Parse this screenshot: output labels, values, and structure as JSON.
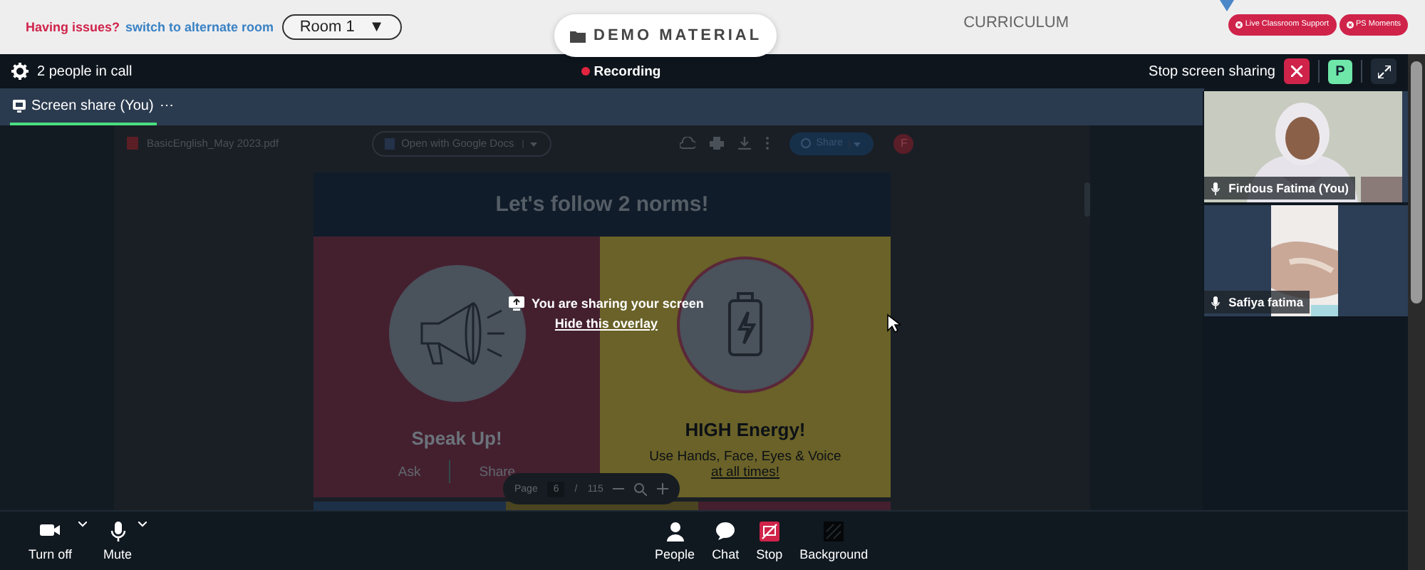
{
  "top_bar": {
    "issue_label": "Having issues?",
    "switch_link": "switch to alternate room",
    "room_select": {
      "value": "Room 1",
      "caret": "▼"
    },
    "demo_button": "DEMO MATERIAL",
    "curriculum_tab": "CURRICULUM",
    "support_buttons": [
      "Live Classroom Support",
      "PS Moments"
    ]
  },
  "call_header": {
    "people_count": "2 people in call",
    "recording": "Recording",
    "stop_sharing": "Stop screen sharing",
    "avatar": "P"
  },
  "tabs": [
    {
      "label": "Screen share (You)",
      "selected": true,
      "more": "⋯"
    }
  ],
  "shared_screen": {
    "file_name": "BasicEnglish_May 2023.pdf",
    "open_with": "Open with Google Docs",
    "share": "Share",
    "account": "F",
    "slide": {
      "title": "Let's follow 2 norms!",
      "left_heading": "Speak Up!",
      "left_items": [
        "Ask",
        "Share"
      ],
      "right_heading": "HIGH Energy!",
      "right_text": "Use Hands, Face, Eyes & Voice",
      "right_link": "at all times!"
    },
    "page_bar": {
      "label": "Page",
      "page": "6",
      "separator": "/",
      "total": "115"
    }
  },
  "overlay": {
    "message": "You are sharing your screen",
    "hide_link": "Hide this overlay"
  },
  "participants": [
    {
      "name": "Firdous Fatima (You)",
      "kind": "portrait"
    },
    {
      "name": "Safiya fatima",
      "kind": "narrow"
    }
  ],
  "left_controls": [
    {
      "label": "Turn off",
      "kind": "camera"
    },
    {
      "label": "Mute",
      "kind": "mic"
    }
  ],
  "center_controls": [
    {
      "label": "People",
      "kind": "people"
    },
    {
      "label": "Chat",
      "kind": "chat"
    },
    {
      "label": "Stop",
      "kind": "stop"
    },
    {
      "label": "Background",
      "kind": "background"
    }
  ]
}
